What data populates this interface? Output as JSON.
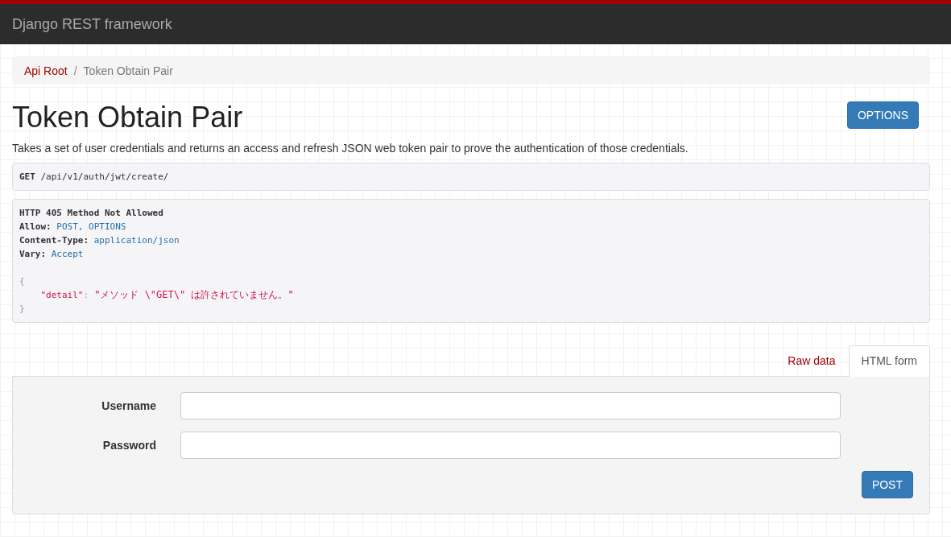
{
  "navbar": {
    "brand": "Django REST framework"
  },
  "breadcrumb": [
    {
      "label": "Api Root",
      "active": false
    },
    {
      "label": "Token Obtain Pair",
      "active": true,
      "separator": "/"
    }
  ],
  "page": {
    "title": "Token Obtain Pair",
    "options_button": "OPTIONS",
    "description": "Takes a set of user credentials and returns an access and refresh JSON web token pair to prove the authentication of those credentials."
  },
  "request": {
    "method": "GET",
    "path": "/api/v1/auth/jwt/create/"
  },
  "response": {
    "status_line": "HTTP 405 Method Not Allowed",
    "headers": [
      {
        "name": "Allow:",
        "value": "POST, OPTIONS"
      },
      {
        "name": "Content-Type:",
        "value": "application/json"
      },
      {
        "name": "Vary:",
        "value": "Accept"
      }
    ],
    "body": {
      "open": "{",
      "entries": [
        {
          "key": "\"detail\"",
          "separator": ":",
          "value": "\"メソッド \\\"GET\\\" は許されていません。\""
        }
      ],
      "close": "}"
    }
  },
  "tabs": [
    {
      "label": "Raw data",
      "selected": false
    },
    {
      "label": "HTML form",
      "selected": true
    }
  ],
  "form": {
    "fields": [
      {
        "label": "Username"
      },
      {
        "label": "Password"
      }
    ],
    "submit": "POST"
  }
}
